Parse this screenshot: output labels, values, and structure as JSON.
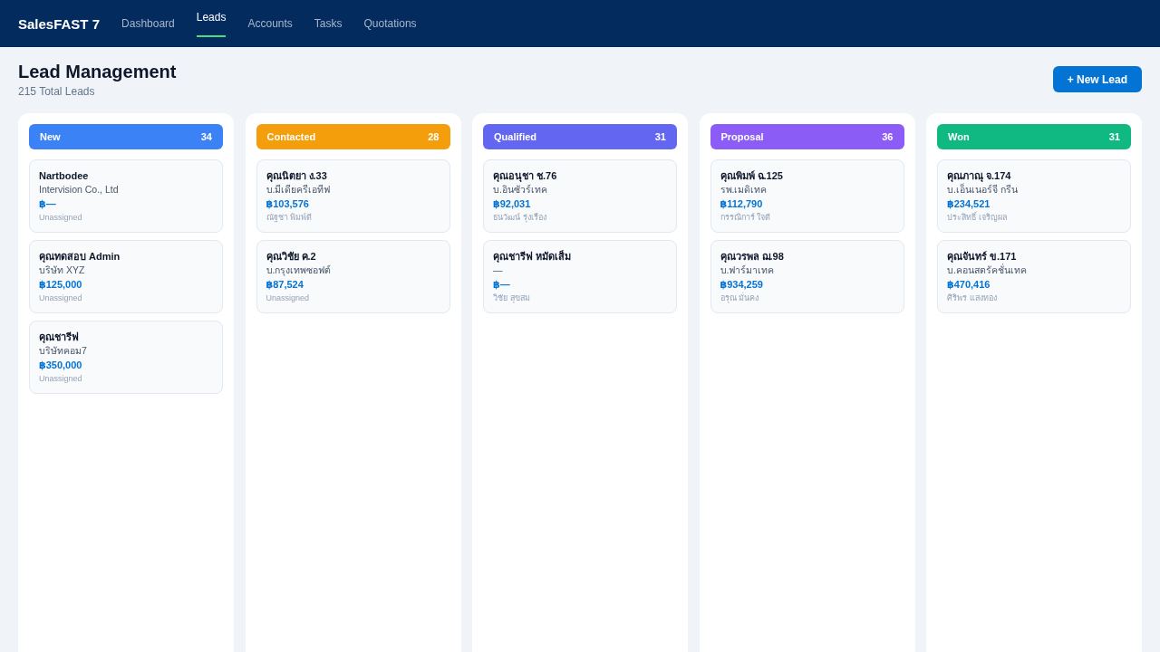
{
  "navbar": {
    "brand": "SalesFAST 7",
    "tabs": [
      {
        "label": "Dashboard",
        "selected": false
      },
      {
        "label": "Leads",
        "selected": true
      },
      {
        "label": "Accounts",
        "selected": false
      },
      {
        "label": "Tasks",
        "selected": false
      },
      {
        "label": "Quotations",
        "selected": false
      }
    ]
  },
  "header": {
    "title": "Lead Management",
    "subtitle": "215 Total Leads",
    "new_lead_button": "+ New Lead"
  },
  "board": {
    "columns": [
      {
        "title": "New",
        "count": "34",
        "color": "#3b82f6",
        "leads": [
          {
            "name": "Nartbodee",
            "company": "Intervision Co., Ltd",
            "value": "฿—",
            "owner": "Unassigned"
          },
          {
            "name": "คุณทดสอบ Admin",
            "company": "บริษัท XYZ",
            "value": "฿125,000",
            "owner": "Unassigned"
          },
          {
            "name": "คุณชารีฟ",
            "company": "บริษัทคอม7",
            "value": "฿350,000",
            "owner": "Unassigned"
          }
        ]
      },
      {
        "title": "Contacted",
        "count": "28",
        "color": "#f59e0b",
        "leads": [
          {
            "name": "คุณนิตยา ง.33",
            "company": "บ.มีเดียครีเอทีฟ",
            "value": "฿103,576",
            "owner": "ณัฐชา พิมพ์ดี"
          },
          {
            "name": "คุณวิชัย ค.2",
            "company": "บ.กรุงเทพซอฟต์",
            "value": "฿87,524",
            "owner": "Unassigned"
          }
        ]
      },
      {
        "title": "Qualified",
        "count": "31",
        "color": "#6366f1",
        "leads": [
          {
            "name": "คุณอนุชา ช.76",
            "company": "บ.อินซัวร์เทค",
            "value": "฿92,031",
            "owner": "ธนวัฒน์ รุ่งเรือง"
          },
          {
            "name": "คุณชารีฟ หมัดเส็ม",
            "company": "—",
            "value": "฿—",
            "owner": "วิชัย สุขสม"
          }
        ]
      },
      {
        "title": "Proposal",
        "count": "36",
        "color": "#8b5cf6",
        "leads": [
          {
            "name": "คุณพิมพ์ ฉ.125",
            "company": "รพ.เมดิเทค",
            "value": "฿112,790",
            "owner": "กรรณิการ์ ใจดี"
          },
          {
            "name": "คุณวรพล ฌ.98",
            "company": "บ.ฟาร์มาเทค",
            "value": "฿934,259",
            "owner": "อรุณ มั่นคง"
          }
        ]
      },
      {
        "title": "Won",
        "count": "31",
        "color": "#10b981",
        "leads": [
          {
            "name": "คุณภาณุ จ.174",
            "company": "บ.เอ็นเนอร์จี กรีน",
            "value": "฿234,521",
            "owner": "ประสิทธิ์ เจริญผล"
          },
          {
            "name": "คุณจันทร์ ข.171",
            "company": "บ.คอนสตรัคชั่นเทค",
            "value": "฿470,416",
            "owner": "ศิริพร แสงทอง"
          }
        ]
      }
    ]
  }
}
